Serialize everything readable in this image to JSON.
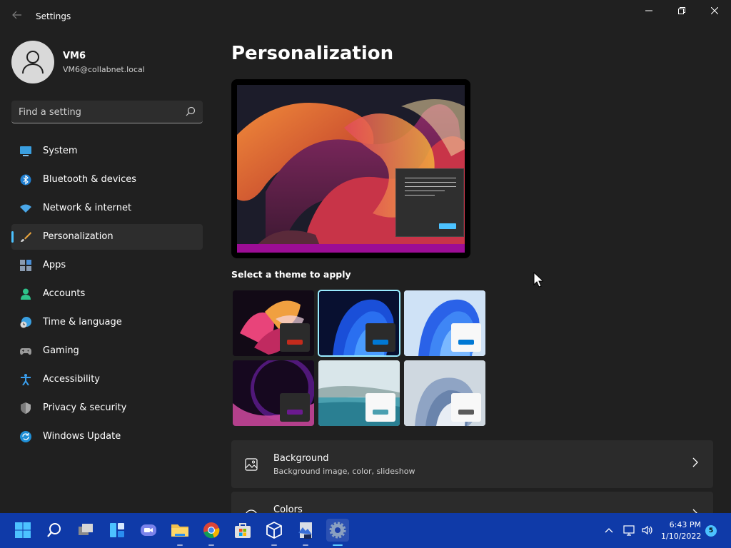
{
  "window": {
    "title": "Settings",
    "back_icon": "back-arrow-icon",
    "controls": [
      "minimize-icon",
      "restore-icon",
      "close-icon"
    ]
  },
  "profile": {
    "name": "VM6",
    "email": "VM6@collabnet.local"
  },
  "search": {
    "placeholder": "Find a setting"
  },
  "sidebar": {
    "items": [
      {
        "label": "System",
        "icon": "monitor-icon",
        "selected": false
      },
      {
        "label": "Bluetooth & devices",
        "icon": "bluetooth-icon",
        "selected": false
      },
      {
        "label": "Network & internet",
        "icon": "wifi-icon",
        "selected": false
      },
      {
        "label": "Personalization",
        "icon": "brush-icon",
        "selected": true
      },
      {
        "label": "Apps",
        "icon": "apps-icon",
        "selected": false
      },
      {
        "label": "Accounts",
        "icon": "person-icon",
        "selected": false
      },
      {
        "label": "Time & language",
        "icon": "clock-globe-icon",
        "selected": false
      },
      {
        "label": "Gaming",
        "icon": "gamepad-icon",
        "selected": false
      },
      {
        "label": "Accessibility",
        "icon": "accessibility-icon",
        "selected": false
      },
      {
        "label": "Privacy & security",
        "icon": "shield-icon",
        "selected": false
      },
      {
        "label": "Windows Update",
        "icon": "update-icon",
        "selected": false
      }
    ]
  },
  "main": {
    "title": "Personalization",
    "theme_section_label": "Select a theme to apply",
    "themes": [
      {
        "name": "glow",
        "selected": false,
        "accent": "#c42b1c"
      },
      {
        "name": "windows-dark",
        "selected": true,
        "accent": "#0078d4"
      },
      {
        "name": "windows-light",
        "selected": false,
        "accent": "#0078d4"
      },
      {
        "name": "captured-motion",
        "selected": false,
        "accent": "#6b1a8f"
      },
      {
        "name": "flow",
        "selected": false,
        "accent": "#4a9fb0"
      },
      {
        "name": "sunrise",
        "selected": false,
        "accent": "#5a5a5a"
      }
    ],
    "cards": [
      {
        "title": "Background",
        "subtitle": "Background image, color, slideshow",
        "icon": "picture-icon"
      },
      {
        "title": "Colors",
        "subtitle": "",
        "icon": "palette-icon"
      }
    ]
  },
  "taskbar": {
    "apps": [
      "start-icon",
      "search-icon",
      "task-view-icon",
      "widgets-icon",
      "chat-icon",
      "file-explorer-icon",
      "chrome-icon",
      "store-icon",
      "3d-viewer-icon",
      "app-icon",
      "settings-icon"
    ],
    "time": "6:43 PM",
    "date": "1/10/2022",
    "notifications": "5"
  },
  "colors": {
    "accent": "#4cc2ff",
    "taskbar": "#0f3aa8",
    "background": "#202020"
  }
}
